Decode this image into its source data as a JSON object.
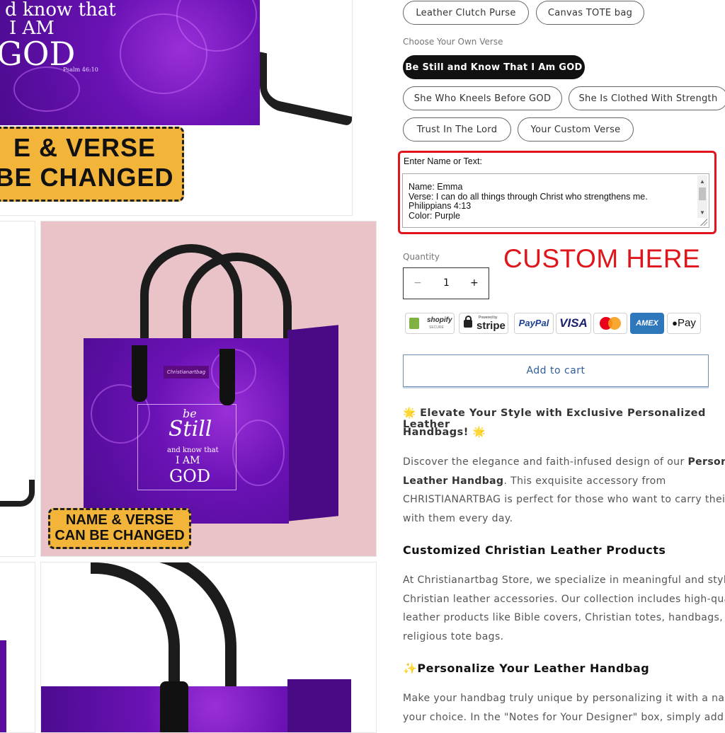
{
  "variant_options": {
    "style": [
      "Leather Clutch Purse",
      "Canvas TOTE bag"
    ],
    "verse_label": "Choose Your Own Verse",
    "verses": [
      "Be Still and Know That I Am GOD",
      "She Who Kneels Before GOD",
      "She Is Clothed With Strength",
      "Trust In The Lord",
      "Your Custom Verse"
    ],
    "selected_verse": "Be Still and Know That I Am GOD"
  },
  "customize": {
    "label": "Enter Name or Text:",
    "lines": [
      "Name: Emma",
      "Verse: I can do all things through Christ who strengthens me.",
      "Philippians 4:13",
      "Color: Purple"
    ],
    "callout": "CUSTOM HERE"
  },
  "quantity": {
    "label": "Quantity",
    "minus": "−",
    "value": "1",
    "plus": "+"
  },
  "payments": {
    "shopify": "shopify",
    "shopify_sub": "SECURE",
    "stripe_top": "Powered by",
    "stripe": "stripe",
    "paypal": "PayPal",
    "visa": "VISA",
    "amex": "AMEX",
    "applepay": "Pay"
  },
  "add_to_cart": "Add to cart",
  "description": {
    "intro_heading_emoji_l": "🌟",
    "intro_heading_line1": "Elevate Your Style with Exclusive Personalized Leather",
    "intro_heading_line2": "Handbags!",
    "intro_heading_emoji_r": "🌟",
    "p1_line1_a": "Discover the elegance and faith-infused design of our ",
    "p1_line1_b": "Personaliz",
    "p1_line2_a": "Leather Handbag",
    "p1_line2_b": ". This exquisite accessory from",
    "p1_line3": "CHRISTIANARTBAG is perfect for those who want to carry their fai",
    "p1_line4": "with them every day.",
    "h_products": "Customized Christian Leather Products",
    "p2_line1": "At Christianartbag Store, we specialize in meaningful and stylish",
    "p2_line2": "Christian leather accessories. Our collection includes high-quality",
    "p2_line3": "leather products like Bible covers, Christian totes, handbags, and",
    "p2_line4": "religious tote bags.",
    "h_personalize_emoji": "✨",
    "h_personalize": "Personalize Your Leather Handbag",
    "p3_line1": "Make your handbag truly unique by personalizing it with a name",
    "p3_line2": "your choice. In the \"Notes for Your Designer\" box, simply add you"
  },
  "gallery": {
    "top_text_1": "d know that",
    "top_text_2": "I AM",
    "top_text_3": "GOD",
    "top_ref": "Psalm 46:10",
    "top_badge_1": "E & VERSE",
    "top_badge_2": "BE CHANGED",
    "bag_be": "be",
    "bag_still": "Still",
    "bag_know": "and know that",
    "bag_iam": "I AM",
    "bag_god": "GOD",
    "bag_brand": "Christianartbag",
    "bag_badge_1": "NAME & VERSE",
    "bag_badge_2": "CAN BE CHANGED"
  },
  "colors": {
    "accent_red": "#e0151b",
    "button_blue": "#2f5e99",
    "bag_purple": "#6a12b5",
    "badge_yellow": "#f3b43a"
  }
}
